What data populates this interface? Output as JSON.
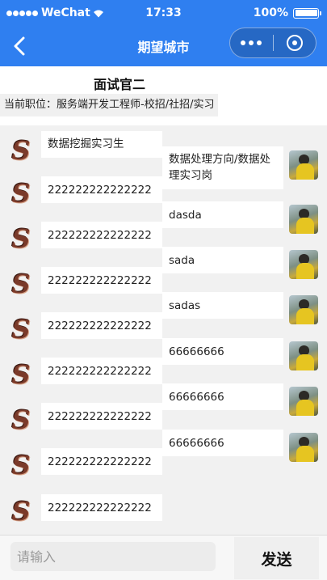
{
  "status_bar": {
    "carrier": "WeChat",
    "time": "17:33",
    "battery": "100%"
  },
  "navbar": {
    "title": "期望城市"
  },
  "header": {
    "interviewer": "面试官二",
    "position_label": "当前职位：",
    "position_value": "服务端开发工程师-校招/社招/实习"
  },
  "messages_left": [
    "数据挖掘实习生",
    "222222222222222",
    "222222222222222",
    "222222222222222",
    "222222222222222",
    "222222222222222",
    "222222222222222",
    "222222222222222",
    "222222222222222"
  ],
  "messages_right": [
    "数据处理方向/数据处理实习岗",
    "dasda",
    "sada",
    "sadas",
    "66666666",
    "66666666",
    "66666666"
  ],
  "input": {
    "placeholder": "请输入",
    "value": ""
  },
  "send_label": "发送"
}
